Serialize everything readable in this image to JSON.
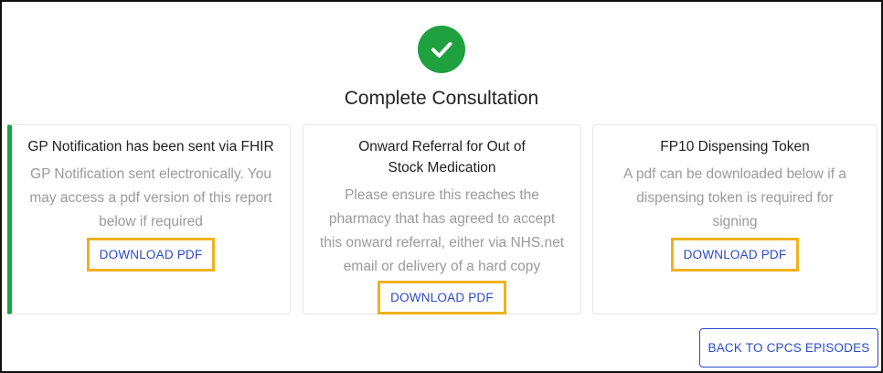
{
  "header": {
    "title": "Complete Consultation",
    "status_icon": "check-circle-icon",
    "status_color": "#1fa140"
  },
  "cards": [
    {
      "title": "GP Notification has been sent via FHIR",
      "body": "GP Notification sent electronically. You may access a pdf version of this report below if required",
      "button_label": "DOWNLOAD PDF",
      "accent_color": "#14a83c"
    },
    {
      "title": "Onward Referral for Out of Stock Medication",
      "body": "Please ensure this reaches the pharmacy that has agreed to accept this onward referral, either via NHS.net email or delivery of a hard copy",
      "button_label": "DOWNLOAD PDF"
    },
    {
      "title": "FP10 Dispensing Token",
      "body": "A pdf can be downloaded below if a dispensing token is required for signing",
      "button_label": "DOWNLOAD PDF"
    }
  ],
  "footer": {
    "back_label": "BACK TO CPCS EPISODES"
  },
  "colors": {
    "highlight": "#f0b11c",
    "link": "#2b49c9"
  }
}
